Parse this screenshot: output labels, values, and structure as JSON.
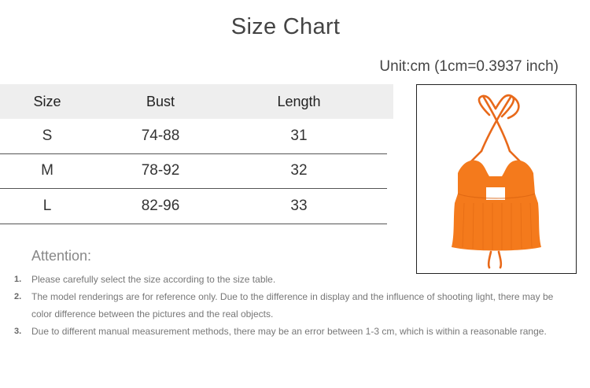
{
  "title": "Size Chart",
  "unit": "Unit:cm (1cm=0.3937 inch)",
  "table": {
    "headers": [
      "Size",
      "Bust",
      "Length"
    ],
    "rows": [
      [
        "S",
        "74-88",
        "31"
      ],
      [
        "M",
        "78-92",
        "32"
      ],
      [
        "L",
        "82-96",
        "33"
      ]
    ]
  },
  "product_image": {
    "color": "#f47a1c",
    "depicts": "orange-halter-crop-top"
  },
  "attention": {
    "heading": "Attention:",
    "notes": [
      {
        "num": "1.",
        "text": "Please carefully select the size according to the size table."
      },
      {
        "num": "2.",
        "text": "The model renderings are for reference only. Due to the difference in display and the influence of shooting light, there may be color difference between the pictures and the real objects."
      },
      {
        "num": "3.",
        "text": "Due to different manual measurement methods, there may be an error between 1-3 cm, which is within a reasonable range."
      }
    ]
  }
}
